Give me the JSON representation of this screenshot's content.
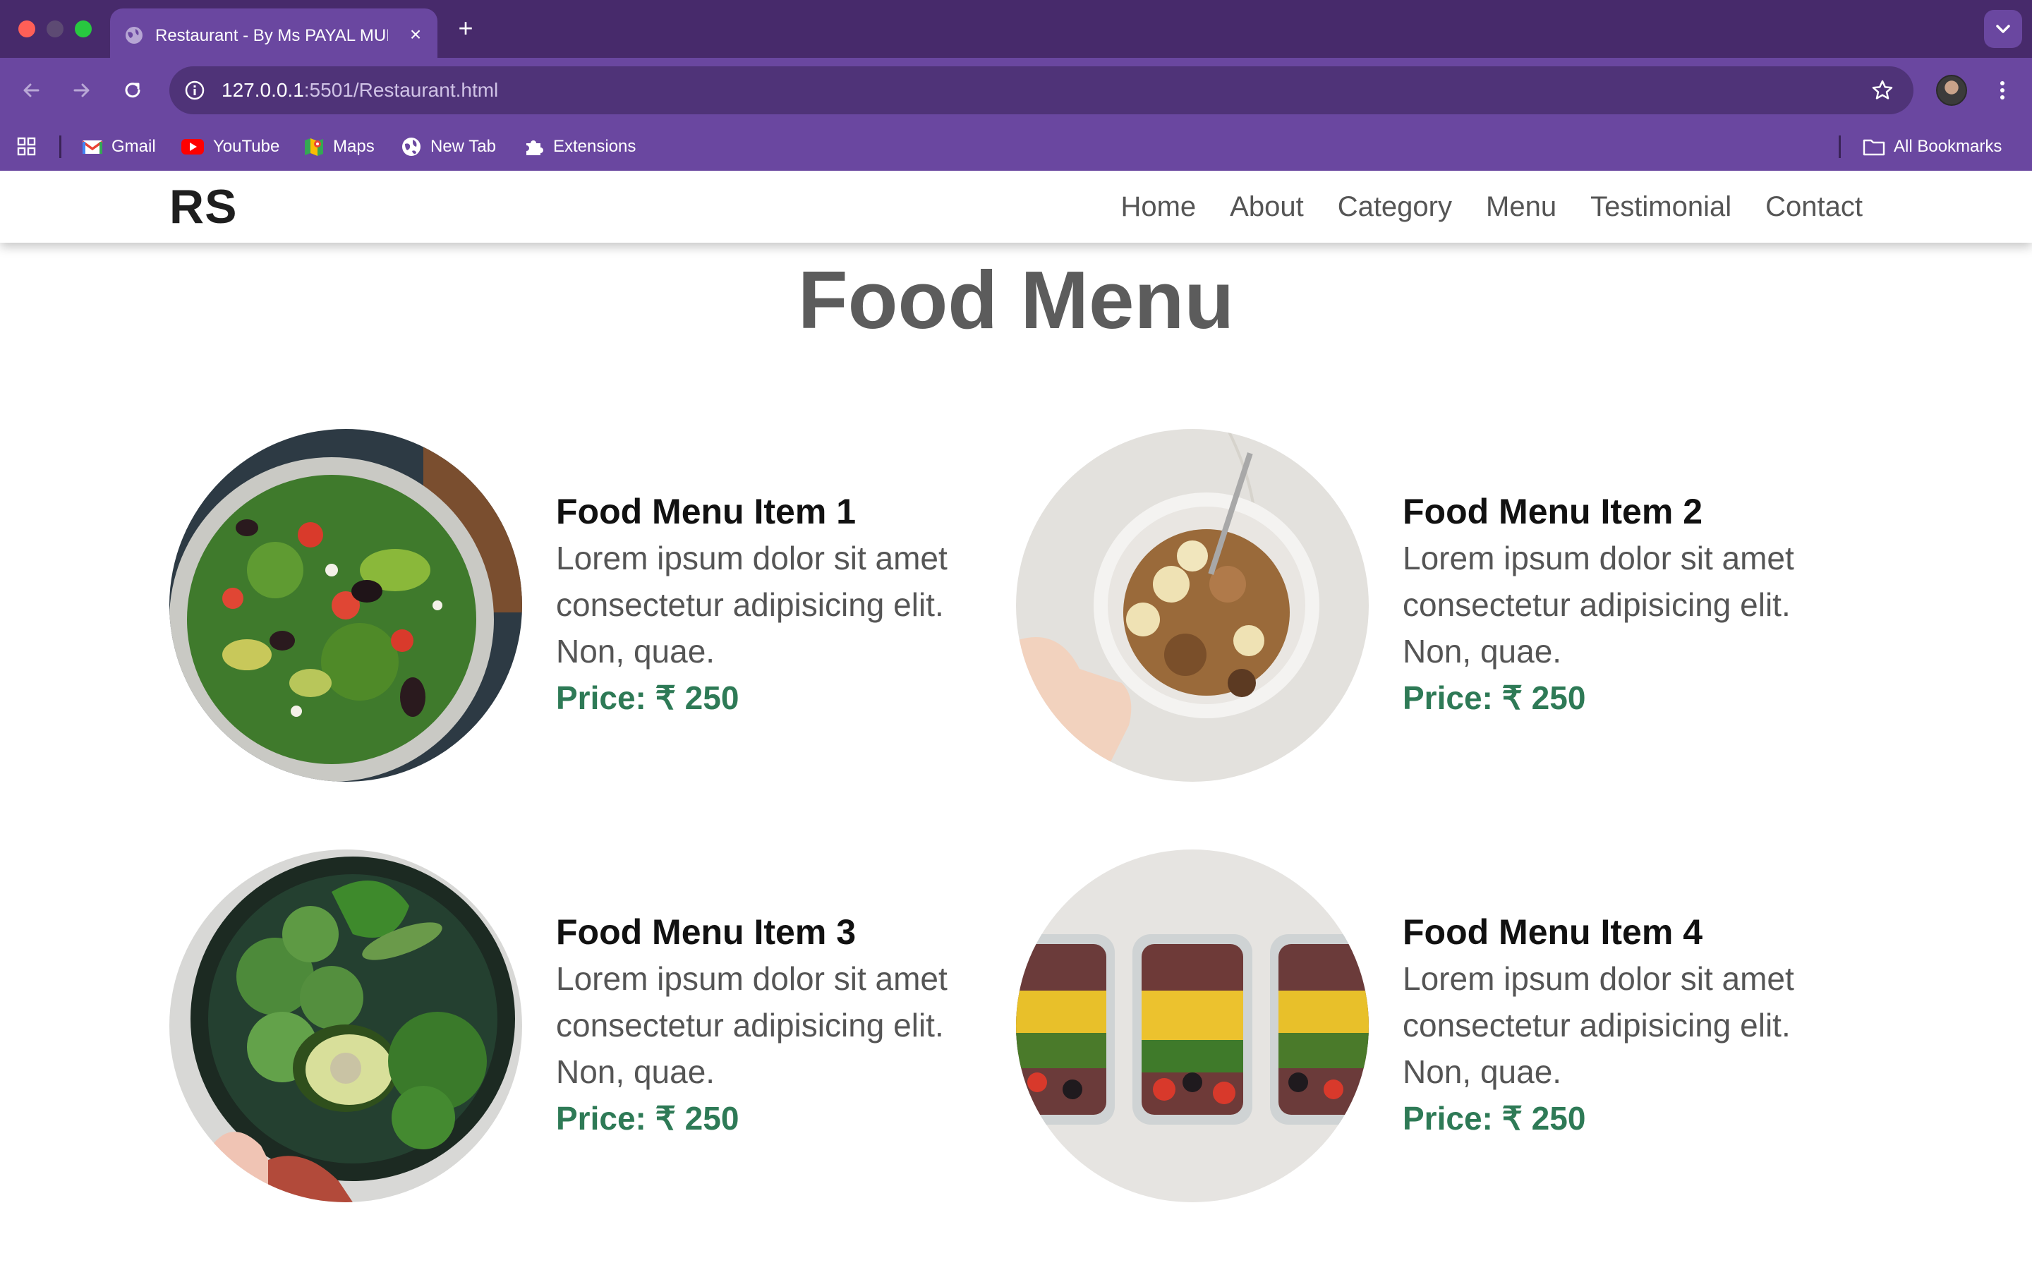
{
  "browser": {
    "tab_title": "Restaurant - By Ms PAYAL MUKHERJEE",
    "new_tab_symbol": "+",
    "tab_close_symbol": "×",
    "url_host": "127.0.0.1",
    "url_rest": ":5501/Restaurant.html",
    "bookmarks": [
      {
        "label": "Gmail",
        "icon": "gmail-icon"
      },
      {
        "label": "YouTube",
        "icon": "youtube-icon"
      },
      {
        "label": "Maps",
        "icon": "maps-icon"
      },
      {
        "label": "New Tab",
        "icon": "globe-icon"
      },
      {
        "label": "Extensions",
        "icon": "puzzle-icon"
      }
    ],
    "all_bookmarks_label": "All Bookmarks",
    "colors": {
      "tabstrip": "#472a6b",
      "toolbar": "#6a47a0",
      "omnibox": "#4f3378"
    }
  },
  "site": {
    "logo": "RS",
    "nav": [
      "Home",
      "About",
      "Category",
      "Menu",
      "Testimonial",
      "Contact"
    ],
    "title": "Food Menu",
    "items": [
      {
        "name": "Food Menu Item 1",
        "description": "Lorem ipsum dolor sit amet consectetur adipisicing elit. Non, quae.",
        "price": "Price: ₹ 250",
        "image": "salad-bowl"
      },
      {
        "name": "Food Menu Item 2",
        "description": "Lorem ipsum dolor sit amet consectetur adipisicing elit. Non, quae.",
        "price": "Price: ₹ 250",
        "image": "granola-banana-bowl"
      },
      {
        "name": "Food Menu Item 3",
        "description": "Lorem ipsum dolor sit amet consectetur adipisicing elit. Non, quae.",
        "price": "Price: ₹ 250",
        "image": "green-vegetables-bowl"
      },
      {
        "name": "Food Menu Item 4",
        "description": "Lorem ipsum dolor sit amet consectetur adipisicing elit. Non, quae.",
        "price": "Price: ₹ 250",
        "image": "meal-prep-containers"
      }
    ],
    "colors": {
      "price": "#2e7a56",
      "title": "#5c5c5c",
      "text": "#555555"
    }
  }
}
